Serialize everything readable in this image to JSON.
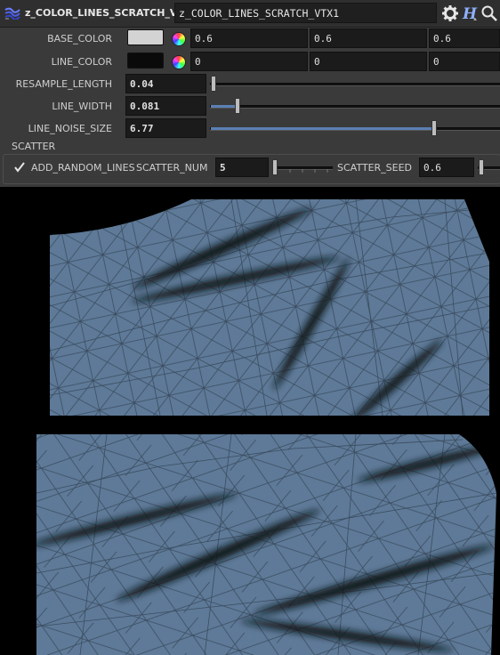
{
  "header": {
    "node_type": "z_COLOR_LINES_SCRATCH_VTX",
    "node_name": "z_COLOR_LINES_SCRATCH_VTX1",
    "icons": [
      "node-type-icon",
      "gear-icon",
      "help-icon",
      "search-icon"
    ]
  },
  "params": {
    "base_color": {
      "label": "BASE_COLOR",
      "swatch": "#d3d3d3",
      "values": [
        "0.6",
        "0.6",
        "0.6"
      ]
    },
    "line_color": {
      "label": "LINE_COLOR",
      "swatch": "#0a0a0a",
      "values": [
        "0",
        "0",
        "0"
      ]
    },
    "resample_length": {
      "label": "RESAMPLE_LENGTH",
      "value": "0.04"
    },
    "line_width": {
      "label": "LINE_WIDTH",
      "value": "0.081"
    },
    "line_noise_size": {
      "label": "LINE_NOISE_SIZE",
      "value": "6.77"
    }
  },
  "scatter": {
    "title": "SCATTER",
    "add_random_lines": {
      "label": "ADD_RANDOM_LINES",
      "checked": true
    },
    "scatter_num": {
      "label": "SCATTER_NUM",
      "value": "5"
    },
    "scatter_seed": {
      "label": "SCATTER_SEED",
      "value": "0.6"
    }
  },
  "colors": {
    "panel": "#3a3a3a",
    "field": "#1b1b1b",
    "accent": "#5b7fb5",
    "mesh": "#5e7a98",
    "wire": "#3b4c5f"
  }
}
